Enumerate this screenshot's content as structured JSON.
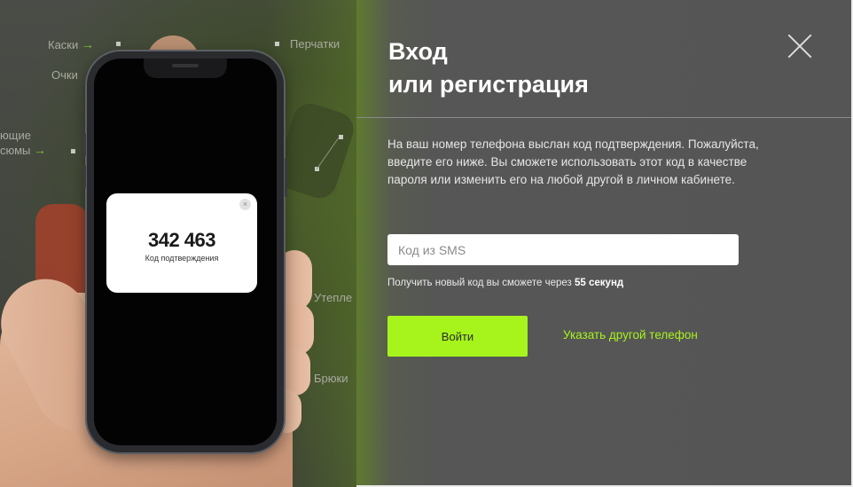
{
  "background": {
    "labels": {
      "helmets": "Каски",
      "gloves": "Перчатки",
      "glasses": "Очки",
      "partial_1": "ющие",
      "partial_2": "сюмы",
      "insulated": "Утепле",
      "trousers": "Брюки"
    }
  },
  "phone": {
    "sms_code": "342 463",
    "sms_caption": "Код подтверждения",
    "close_glyph": "×"
  },
  "modal": {
    "title_line1": "Вход",
    "title_line2": "или регистрация",
    "description": "На ваш номер телефона выслан код подтверждения. Пожалуйста, введите его ниже. Вы сможете использовать этот код в качестве пароля или изменить его на любой другой в личном кабинете.",
    "input_placeholder": "Код из SMS",
    "input_value": "",
    "timer_prefix": "Получить новый код вы сможете через ",
    "timer_value": "55 секунд",
    "login_button": "Войти",
    "other_phone_link": "Указать другой телефон"
  },
  "colors": {
    "accent": "#a6f41c",
    "panel_bg": "#555555",
    "text_light": "#e6e6e6"
  }
}
